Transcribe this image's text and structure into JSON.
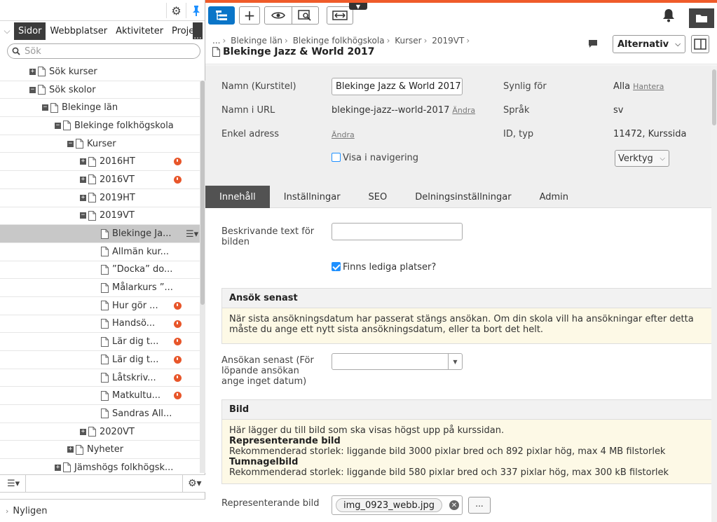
{
  "left_panel": {
    "tabs": [
      "Sidor",
      "Webbplatser",
      "Aktiviteter",
      "Proje"
    ],
    "tab_more": "...",
    "search_placeholder": "Sök",
    "tree": [
      {
        "label": "Sök kurser",
        "level": 0,
        "toggle": "+",
        "alert": false
      },
      {
        "label": "Sök skolor",
        "level": 0,
        "toggle": "-",
        "alert": false
      },
      {
        "label": "Blekinge län",
        "level": 1,
        "toggle": "-",
        "alert": false
      },
      {
        "label": "Blekinge folkhögskola",
        "level": 2,
        "toggle": "-",
        "alert": false
      },
      {
        "label": "Kurser",
        "level": 3,
        "toggle": "-",
        "alert": false
      },
      {
        "label": "2016HT",
        "level": 4,
        "toggle": "+",
        "alert": true
      },
      {
        "label": "2016VT",
        "level": 4,
        "toggle": "+",
        "alert": true
      },
      {
        "label": "2019HT",
        "level": 4,
        "toggle": "+",
        "alert": false
      },
      {
        "label": "2019VT",
        "level": 4,
        "toggle": "-",
        "alert": false
      },
      {
        "label": "Blekinge Ja...",
        "level": 5,
        "toggle": "",
        "alert": false,
        "selected": true
      },
      {
        "label": "Allmän kur...",
        "level": 5,
        "toggle": "",
        "alert": false
      },
      {
        "label": "”Docka” do...",
        "level": 5,
        "toggle": "",
        "alert": false
      },
      {
        "label": "Målarkurs ”...",
        "level": 5,
        "toggle": "",
        "alert": false
      },
      {
        "label": "Hur gör ...",
        "level": 5,
        "toggle": "",
        "alert": true
      },
      {
        "label": "Handsö...",
        "level": 5,
        "toggle": "",
        "alert": true
      },
      {
        "label": "Lär dig t...",
        "level": 5,
        "toggle": "",
        "alert": true
      },
      {
        "label": "Lär dig t...",
        "level": 5,
        "toggle": "",
        "alert": true
      },
      {
        "label": "Låtskriv...",
        "level": 5,
        "toggle": "",
        "alert": true
      },
      {
        "label": "Matkultu...",
        "level": 5,
        "toggle": "",
        "alert": true
      },
      {
        "label": "Sandras All...",
        "level": 5,
        "toggle": "",
        "alert": false
      },
      {
        "label": "2020VT",
        "level": 4,
        "toggle": "+",
        "alert": false
      },
      {
        "label": "Nyheter",
        "level": 3,
        "toggle": "+",
        "alert": false
      },
      {
        "label": "Jämshögs folkhögsk...",
        "level": 2,
        "toggle": "+",
        "alert": false
      }
    ],
    "recent": "Nyligen"
  },
  "header": {
    "breadcrumb": [
      "...",
      "Blekinge län",
      "Blekinge folkhögskola",
      "Kurser",
      "2019VT"
    ],
    "title": "Blekinge Jazz & World 2017",
    "options_button": "Alternativ"
  },
  "properties": {
    "name_label": "Namn (Kurstitel)",
    "name_value": "Blekinge Jazz & World 2017",
    "url_label": "Namn i URL",
    "url_value": "blekinge-jazz--world-2017",
    "url_change": "Ändra",
    "simple_address_label": "Enkel adress",
    "simple_address_change": "Ändra",
    "show_in_nav_label": "Visa i navigering",
    "visible_for_label": "Synlig för",
    "visible_for_value": "Alla",
    "visible_for_manage": "Hantera",
    "language_label": "Språk",
    "language_value": "sv",
    "id_type_label": "ID, typ",
    "id_type_value": "11472, Kurssida",
    "tools_button": "Verktyg"
  },
  "content_tabs": [
    "Innehåll",
    "Inställningar",
    "SEO",
    "Delningsinställningar",
    "Admin"
  ],
  "form": {
    "image_alt_label": "Beskrivande text för bilden",
    "available_places_label": "Finns lediga platser?",
    "apply_section_title": "Ansök senast",
    "apply_section_text": "När sista ansökningsdatum har passerat stängs ansökan. Om din skola vill ha ansökningar efter detta måste du ange ett nytt sista ansökningsdatum, eller ta bort det helt.",
    "apply_date_label": "Ansökan senast (För löpande ansökan ange inget datum)",
    "image_section_title": "Bild",
    "image_section_intro": "Här lägger du till bild som ska visas högst upp på kurssidan.",
    "rep_image_heading": "Representerande bild",
    "rep_image_text": "Rekommenderad storlek: liggande bild 3000 pixlar bred och 892 pixlar hög, max 4 MB filstorlek",
    "thumb_heading": "Tumnagelbild",
    "thumb_text": "Rekommenderad storlek: liggande bild 580 pixlar bred och 337 pixlar hög, max 300 kB filstorlek",
    "rep_image_label": "Representerande bild",
    "rep_image_value": "img_0923_webb.jpg",
    "browse_label": "..."
  },
  "colors": {
    "accent": "#ef5b2a",
    "primary": "#0a75c8",
    "alert": "#e8562a"
  }
}
